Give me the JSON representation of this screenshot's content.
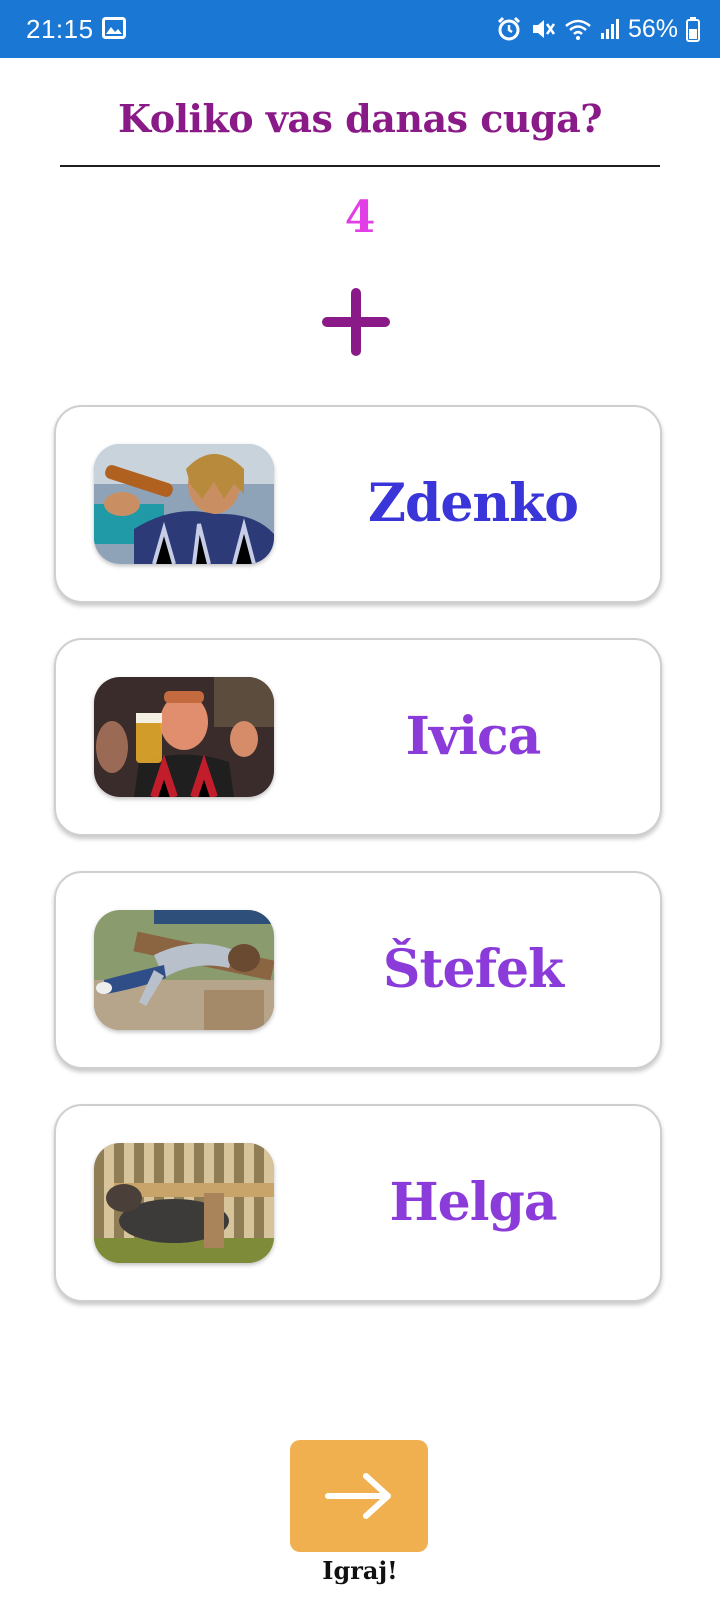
{
  "status_bar": {
    "time": "21:15",
    "battery": "56%",
    "icons": [
      "gallery-icon",
      "alarm-icon",
      "mute-icon",
      "wifi-icon",
      "signal-icon",
      "battery-icon"
    ],
    "background": "#1a77d4"
  },
  "header": {
    "title": "Koliko vas danas cuga?",
    "count": "4",
    "add_icon": "plus-icon"
  },
  "players": [
    {
      "name": "Zdenko",
      "color": "#3a35d8"
    },
    {
      "name": "Ivica",
      "color": "#8b3bd9"
    },
    {
      "name": "Štefek",
      "color": "#8b3bd9"
    },
    {
      "name": "Helga",
      "color": "#8b3bd9"
    }
  ],
  "play": {
    "label": "Igraj!",
    "icon": "arrow-right-icon",
    "color": "#f0b04f"
  },
  "colors": {
    "title": "#8a1a87",
    "count": "#e23ee6"
  }
}
